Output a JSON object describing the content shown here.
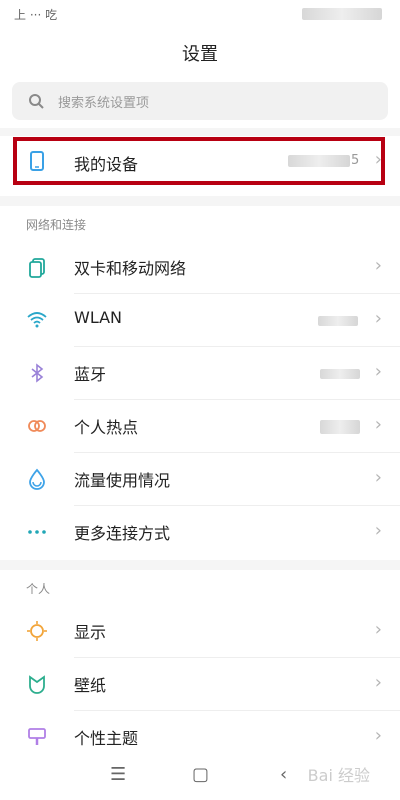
{
  "status": {
    "left_text": "上 ··· 吃"
  },
  "header": {
    "title": "设置"
  },
  "search": {
    "placeholder": "搜索系统设置项"
  },
  "my_device": {
    "label": "我的设备",
    "value_suffix": "5"
  },
  "sections": [
    {
      "title": "网络和连接",
      "items": [
        {
          "label": "双卡和移动网络",
          "icon": "sim-card-icon",
          "color": "#20a89b"
        },
        {
          "label": "WLAN",
          "icon": "wifi-icon",
          "color": "#2aa7c9"
        },
        {
          "label": "蓝牙",
          "icon": "bluetooth-icon",
          "color": "#9a82d8"
        },
        {
          "label": "个人热点",
          "icon": "hotspot-icon",
          "color": "#f08a59"
        },
        {
          "label": "流量使用情况",
          "icon": "data-usage-icon",
          "color": "#3ea3e8"
        },
        {
          "label": "更多连接方式",
          "icon": "more-dots-icon",
          "color": "#21a7b6"
        }
      ]
    },
    {
      "title": "个人",
      "items": [
        {
          "label": "显示",
          "icon": "display-icon",
          "color": "#f2a53b"
        },
        {
          "label": "壁纸",
          "icon": "wallpaper-icon",
          "color": "#2dae8e"
        },
        {
          "label": "个性主题",
          "icon": "theme-icon",
          "color": "#b07fe6"
        }
      ]
    }
  ],
  "nav": {
    "menu": "☰",
    "home": "▢",
    "back": "‹"
  },
  "watermark": "Bai 经验"
}
